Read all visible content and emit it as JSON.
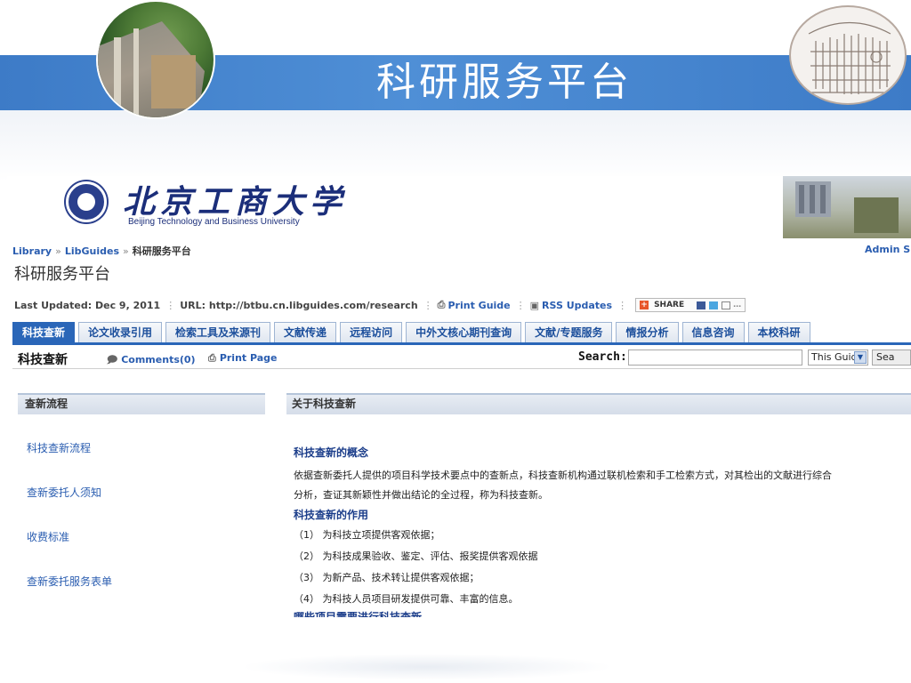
{
  "slide": {
    "title": "科研服务平台"
  },
  "logo": {
    "name_cn": "北京工商大学",
    "name_en": "Beijing Technology and Business University"
  },
  "breadcrumb": {
    "library": "Library",
    "sep": "»",
    "libguides": "LibGuides",
    "current": "科研服务平台",
    "admin": "Admin Si"
  },
  "guide": {
    "title": "科研服务平台"
  },
  "meta": {
    "last_updated": "Last Updated: Dec 9, 2011",
    "url": "URL: http://btbu.cn.libguides.com/research",
    "print_guide": "Print Guide",
    "rss": "RSS Updates",
    "share": "SHARE"
  },
  "tabs": [
    {
      "label": "科技查新",
      "active": true
    },
    {
      "label": "论文收录引用",
      "active": false
    },
    {
      "label": "检索工具及来源刊",
      "active": false
    },
    {
      "label": "文献传递",
      "active": false
    },
    {
      "label": "远程访问",
      "active": false
    },
    {
      "label": "中外文核心期刊查询",
      "active": false
    },
    {
      "label": "文献/专题服务",
      "active": false
    },
    {
      "label": "情报分析",
      "active": false
    },
    {
      "label": "信息咨询",
      "active": false
    },
    {
      "label": "本校科研",
      "active": false
    }
  ],
  "subbar": {
    "page_name": "科技查新",
    "comments": "Comments(0)",
    "print_page": "Print Page",
    "search_label": "Search:",
    "search_value": "",
    "scope": "This Guide",
    "search_button": "Sea"
  },
  "left_box": {
    "title": "查新流程",
    "links": [
      "科技查新流程",
      "查新委托人须知",
      "收费标准",
      "查新委托服务表单"
    ]
  },
  "right_box": {
    "title": "关于科技查新",
    "heading1": "科技查新的概念",
    "para1_line1": "依据查新委托人提供的项目科学技术要点中的查新点，科技查新机构通过联机检索和手工检索方式，对其检出的文献进行综合",
    "para1_line2": "分析，查证其新颖性并做出结论的全过程，称为科技查新。",
    "heading2": "科技查新的作用",
    "items": [
      "（1） 为科技立项提供客观依据；",
      "（2） 为科技成果验收、鉴定、评估、报奖提供客观依据",
      "（3） 为新产品、技术转让提供客观依据；",
      "（4） 为科技人员项目研发提供可靠、丰富的信息。"
    ],
    "heading3": "哪些项目需要进行科技查新"
  },
  "colors": {
    "band": "#4f8fd6",
    "tab_active": "#2a66b8",
    "link": "#2a5db0",
    "logo_blue": "#1b2e7a"
  },
  "icons": [
    "print-icon",
    "rss-icon",
    "share-plus-icon",
    "comment-icon",
    "dropdown-arrow-icon",
    "university-emblem-icon"
  ]
}
